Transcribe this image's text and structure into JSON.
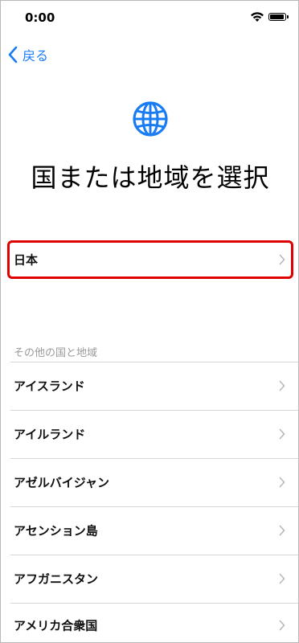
{
  "status_bar": {
    "time": "0:00",
    "icons": [
      "wifi-icon",
      "battery-icon"
    ]
  },
  "nav": {
    "back_label": "戻る",
    "back_icon": "chevron-left-icon"
  },
  "header": {
    "icon": "globe-icon",
    "title": "国または地域を選択"
  },
  "selected_region": {
    "label": "日本"
  },
  "other_regions": {
    "header": "その他の国と地域",
    "items": [
      {
        "label": "アイスランド"
      },
      {
        "label": "アイルランド"
      },
      {
        "label": "アゼルバイジャン"
      },
      {
        "label": "アセンション島"
      },
      {
        "label": "アフガニスタン"
      },
      {
        "label": "アメリカ合衆国"
      }
    ]
  },
  "colors": {
    "accent": "#1a7cf3",
    "highlight": "#e00000",
    "separator": "#d6d6d6",
    "section_header": "#9a9a9a"
  }
}
